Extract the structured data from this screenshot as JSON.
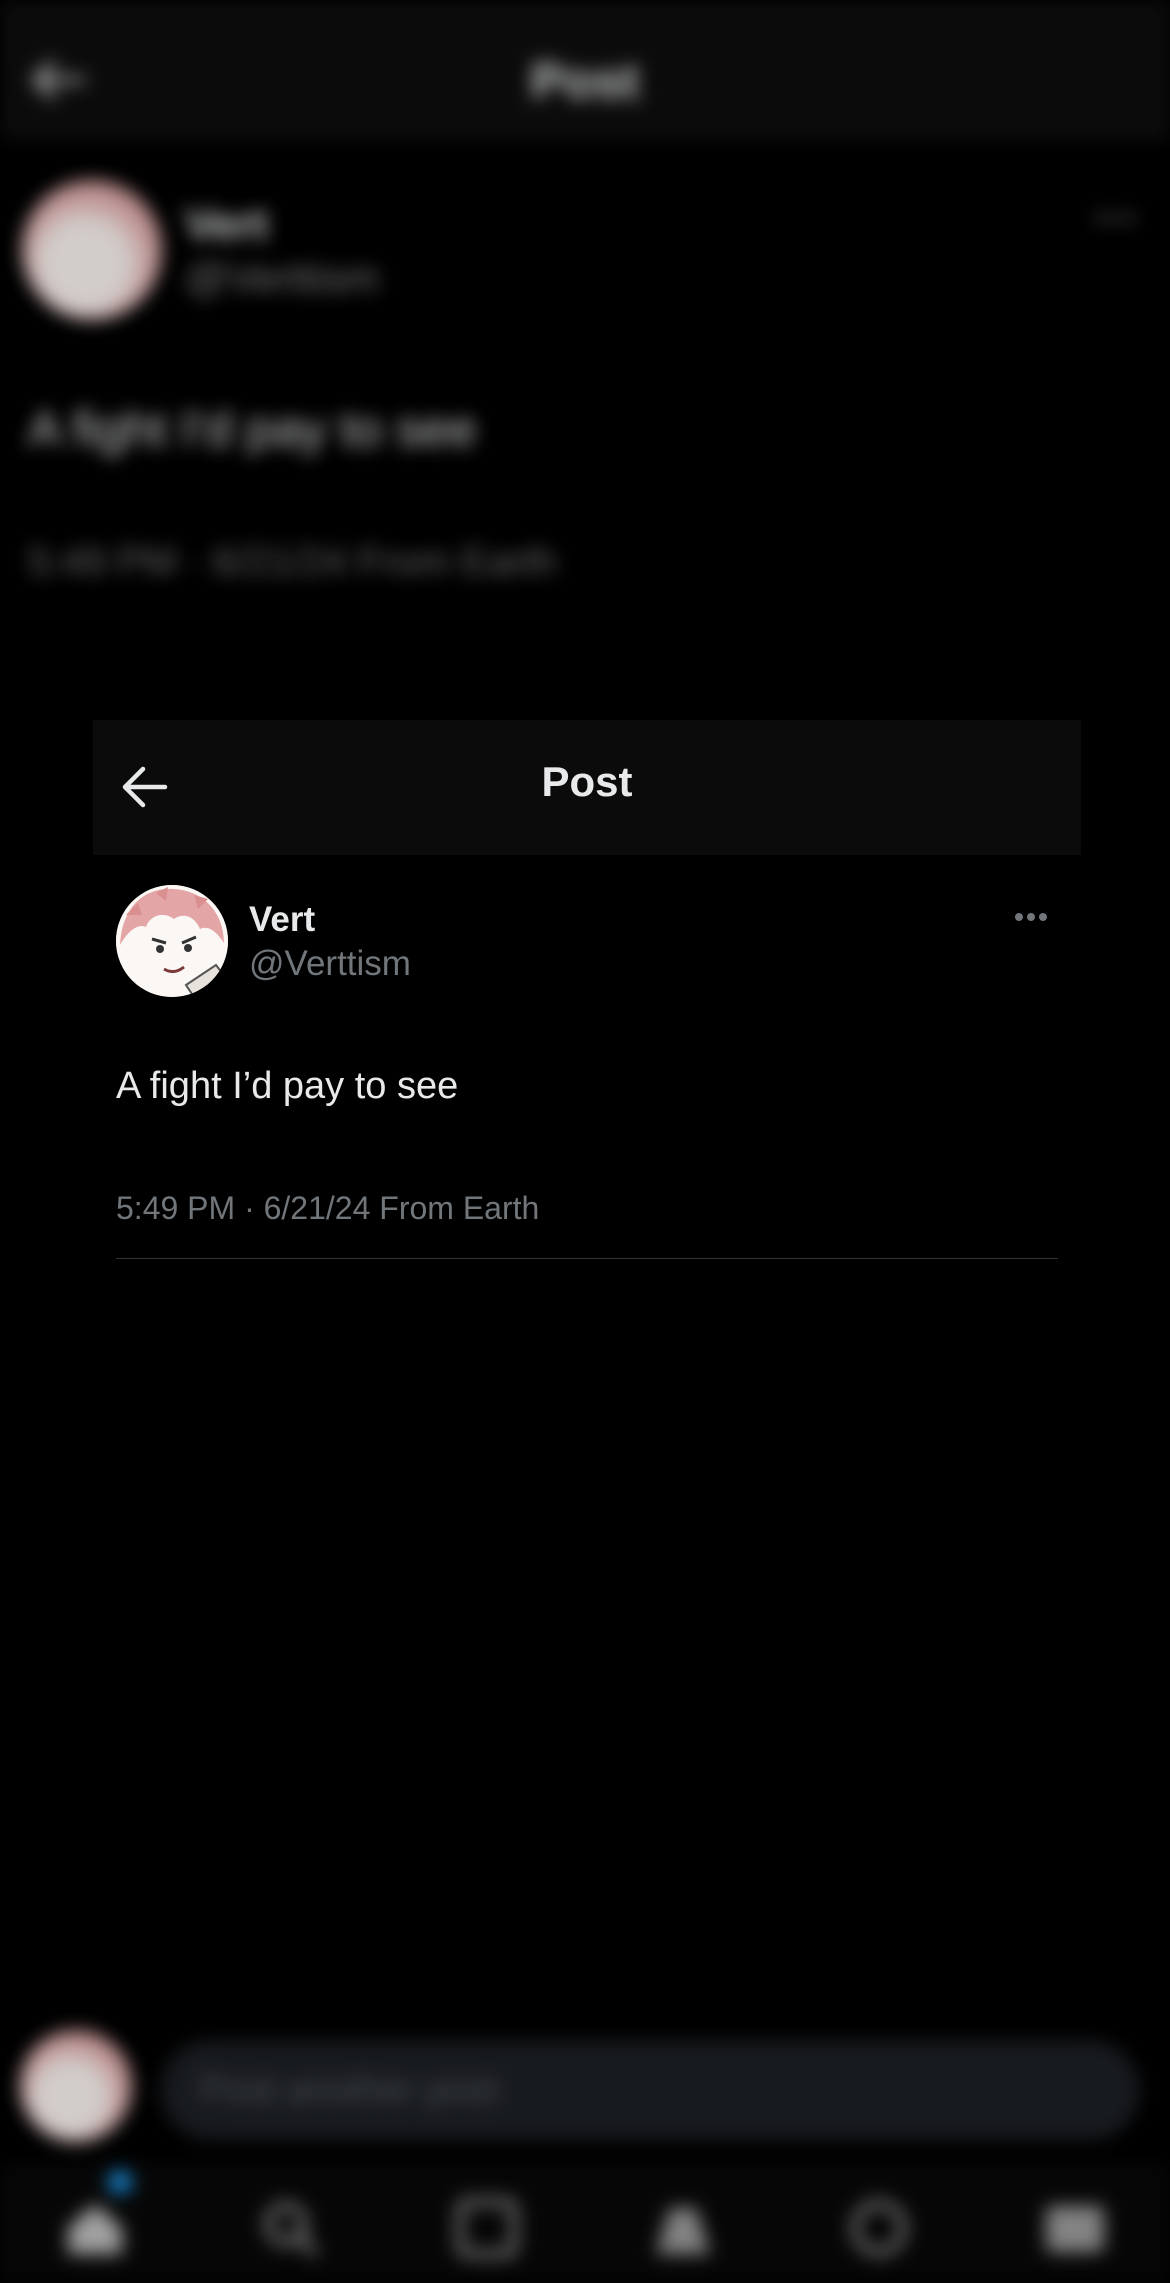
{
  "background_screen": {
    "header": {
      "title": "Post"
    },
    "post": {
      "author_name": "Vert",
      "author_handle": "@Verttism",
      "text": "A fight I'd pay to see",
      "meta": "5:49 PM · 6/21/24 From Earth"
    },
    "reply_bar": {
      "placeholder": "Post another post"
    },
    "tab_bar": {
      "items": [
        "home-icon",
        "search-icon",
        "grok-icon",
        "communities-icon",
        "notifications-icon",
        "messages-icon"
      ]
    },
    "colors": {
      "notification_dot": "#1d9bf0"
    }
  },
  "card": {
    "header": {
      "title": "Post"
    },
    "post": {
      "author_name": "Vert",
      "author_handle": "@Verttism",
      "text": "A fight I’d pay to see",
      "time": "5:49 PM",
      "separator": "·",
      "date": "6/21/24",
      "location": "From Earth"
    }
  },
  "colors": {
    "background": "#000000",
    "primary_text": "#e7e9ea",
    "secondary_text": "#71767b",
    "divider": "#2f3336"
  }
}
